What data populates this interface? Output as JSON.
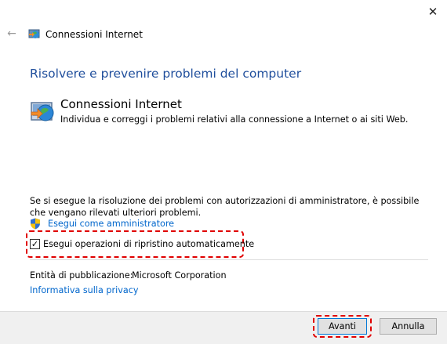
{
  "window": {
    "title": "Connessioni Internet",
    "close_glyph": "✕",
    "back_glyph": "←"
  },
  "page": {
    "heading": "Risolvere e prevenire problemi del computer",
    "troubleshooter": {
      "title": "Connessioni Internet",
      "description": "Individua e correggi i problemi relativi alla connessione a Internet o ai siti Web.",
      "icon": "network-troubleshooter-icon"
    },
    "admin_notice": "Se si esegue la risoluzione dei problemi con autorizzazioni di amministratore, è possibile che vengano rilevati ulteriori problemi.",
    "admin_link": "Esegui come amministratore",
    "auto_repair": {
      "label": "Esegui operazioni di ripristino automaticamente",
      "checked": true,
      "check_glyph": "✓"
    },
    "publisher_label": "Entità di pubblicazione:",
    "publisher_value": "Microsoft Corporation",
    "privacy_link": "Informativa sulla privacy"
  },
  "footer": {
    "next_label": "Avanti",
    "cancel_label": "Annulla"
  },
  "colors": {
    "heading": "#1f4e9c",
    "link": "#0066cc",
    "highlight": "#e00000"
  }
}
